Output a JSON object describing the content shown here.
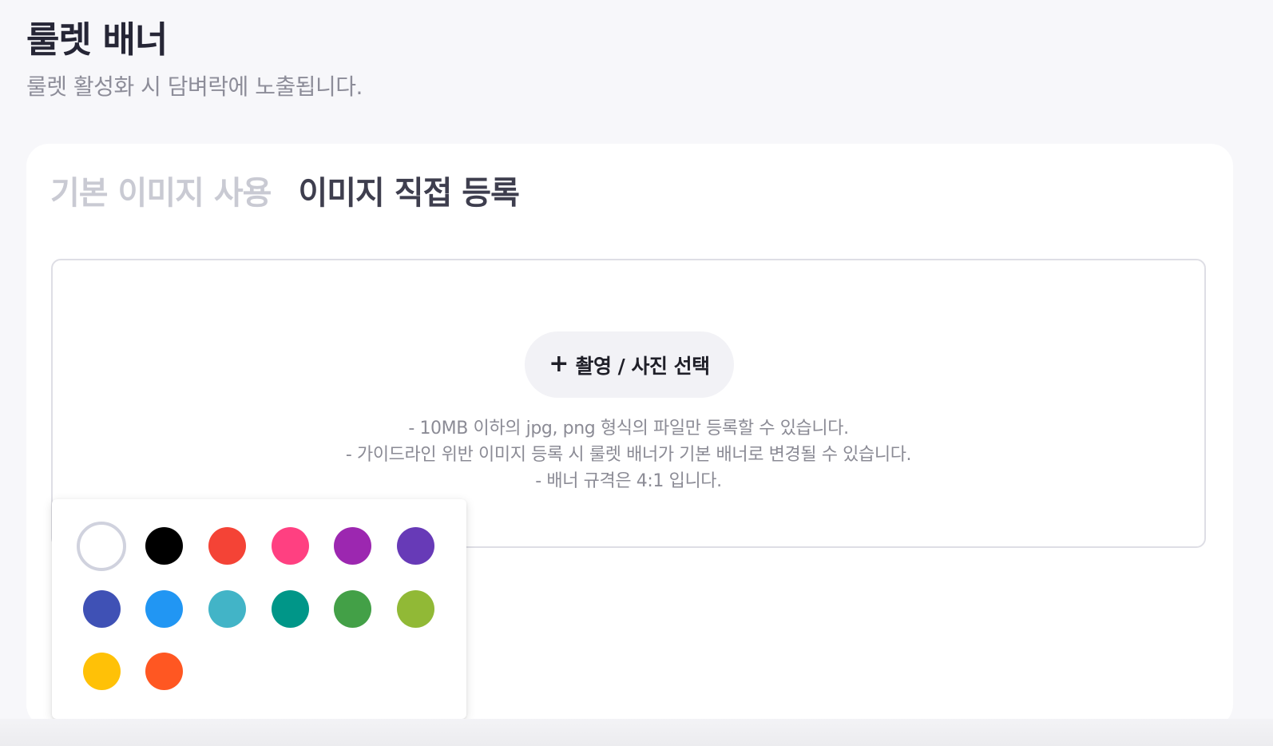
{
  "header": {
    "title": "룰렛 배너",
    "subtitle": "룰렛 활성화 시 담벼락에 노출됩니다."
  },
  "tabs": [
    {
      "label": "기본 이미지 사용",
      "active": false
    },
    {
      "label": "이미지 직접 등록",
      "active": true
    }
  ],
  "upload": {
    "icon": "plus-icon",
    "plus_glyph": "+",
    "button_label": "촬영 / 사진 선택",
    "guidelines": [
      "- 10MB 이하의 jpg, png 형식의 파일만 등록할 수 있습니다.",
      "- 가이드라인 위반 이미지 등록 시 룰렛 배너가 기본 배너로 변경될 수 있습니다.",
      "- 배너 규격은 4:1 입니다."
    ]
  },
  "palette": {
    "selected": "#ffffff",
    "colors": [
      "#ffffff",
      "#000000",
      "#f44336",
      "#ff4081",
      "#9c27b0",
      "#673ab7",
      "#3f51b5",
      "#2196f3",
      "#42b4c7",
      "#009688",
      "#43a047",
      "#91b936",
      "#ffc107",
      "#ff5722"
    ]
  }
}
